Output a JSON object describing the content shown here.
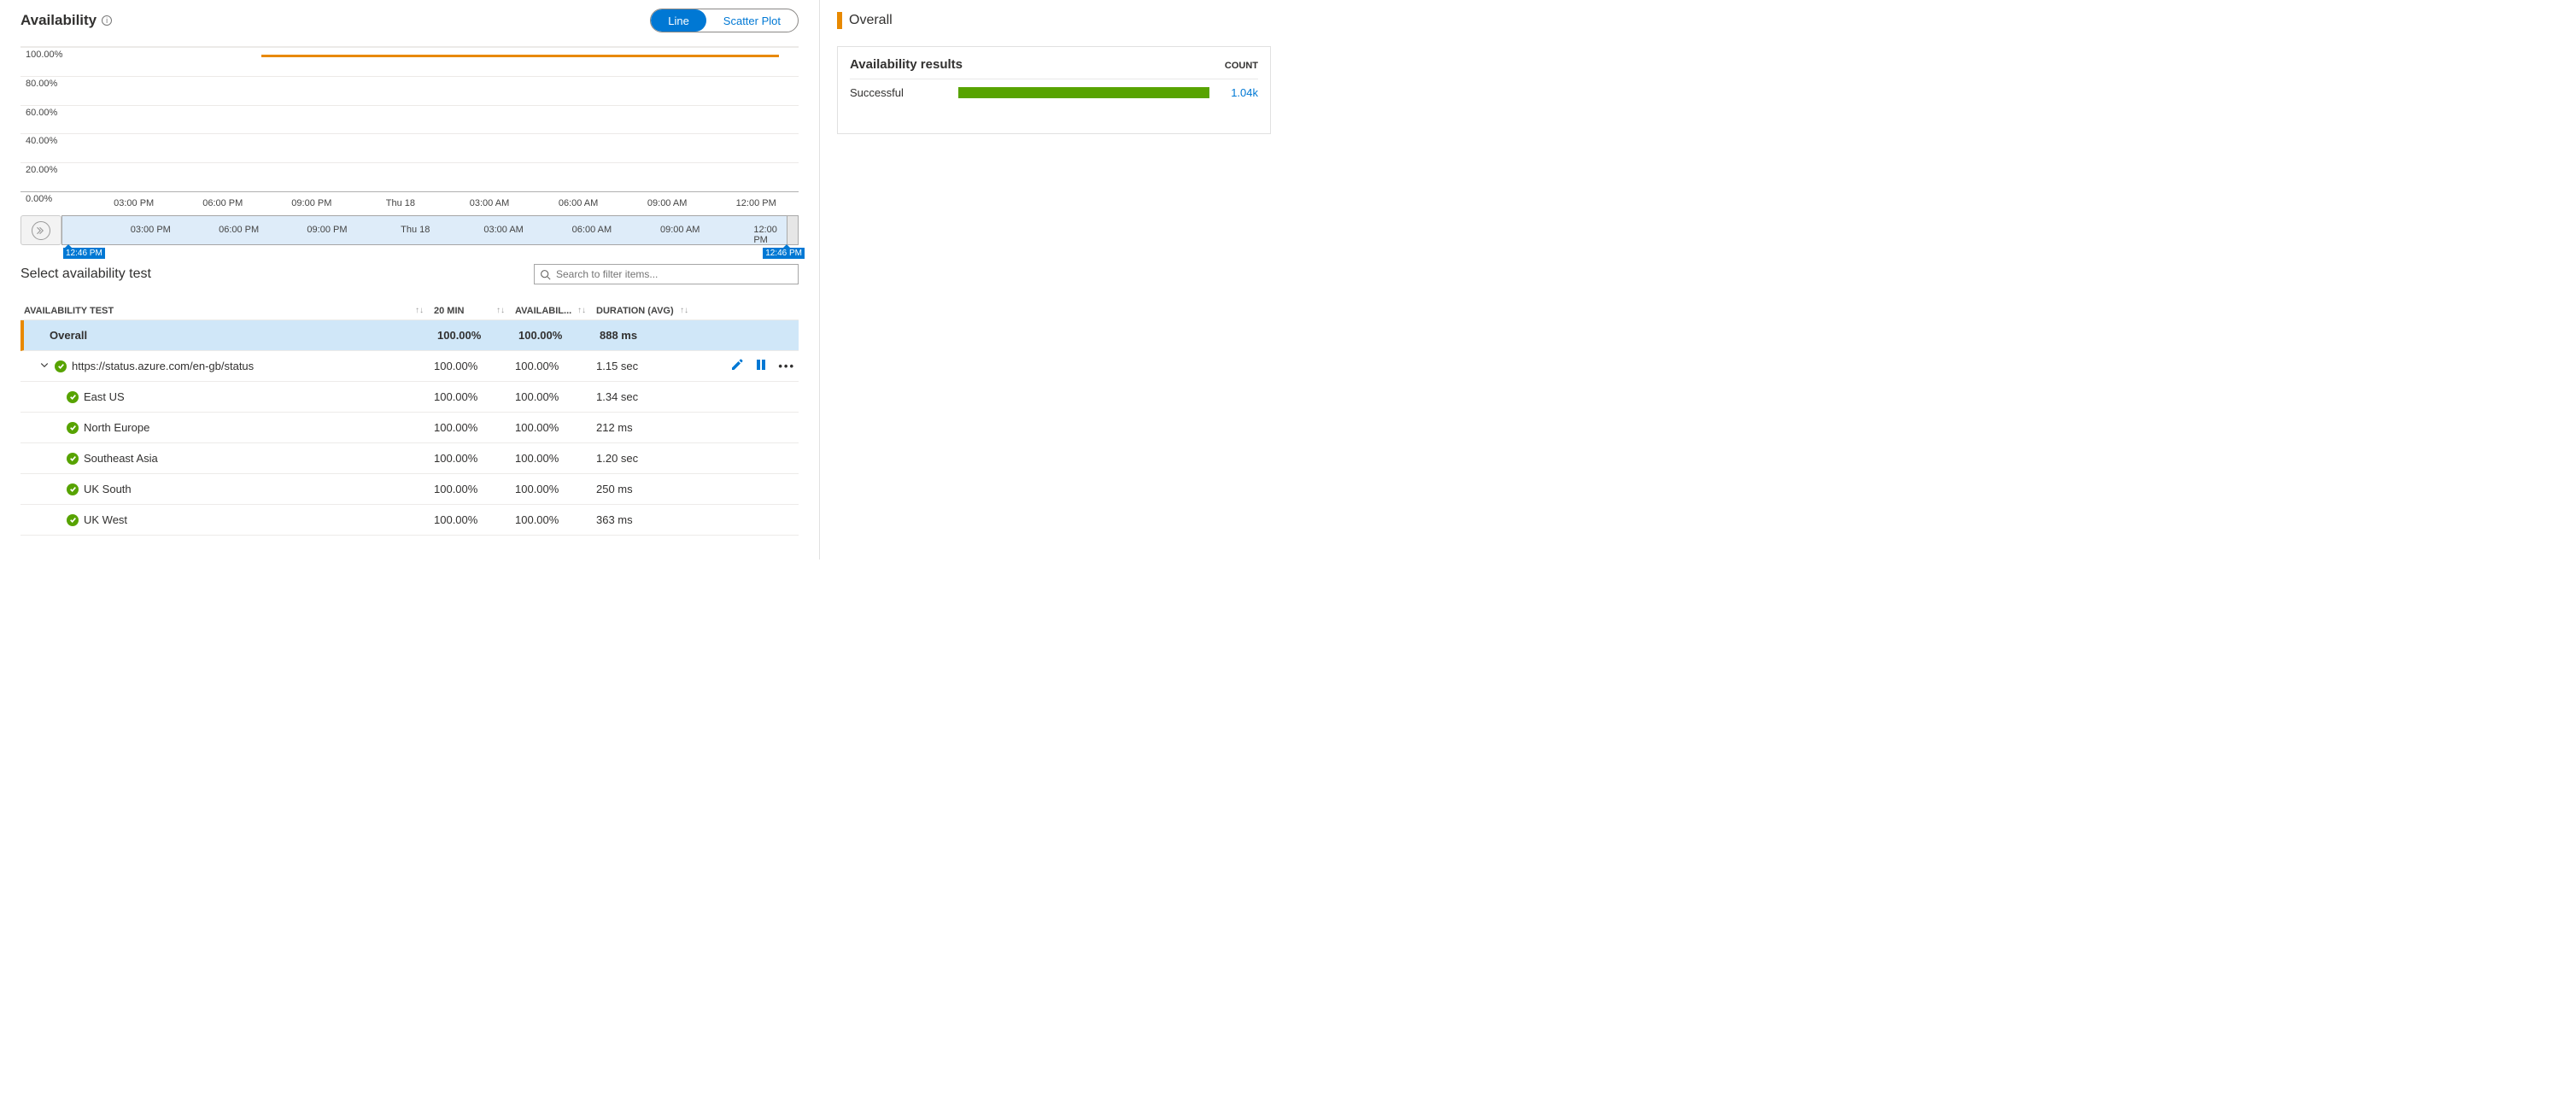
{
  "title": "Availability",
  "chart_toggle": {
    "line": "Line",
    "scatter": "Scatter Plot"
  },
  "chart_data": {
    "type": "line",
    "title": "Availability",
    "ylabel": "",
    "ylim": [
      0,
      100
    ],
    "y_ticks": [
      "100.00%",
      "80.00%",
      "60.00%",
      "40.00%",
      "20.00%",
      "0.00%"
    ],
    "x_ticks": [
      "03:00 PM",
      "06:00 PM",
      "09:00 PM",
      "Thu 18",
      "03:00 AM",
      "06:00 AM",
      "09:00 AM",
      "12:00 PM"
    ],
    "series": [
      {
        "name": "Overall",
        "value_pct": 100,
        "span_start_frac": 0.31,
        "span_end_frac": 0.975
      }
    ]
  },
  "timeline": {
    "x_ticks": [
      "03:00 PM",
      "06:00 PM",
      "09:00 PM",
      "Thu 18",
      "03:00 AM",
      "06:00 AM",
      "09:00 AM",
      "12:00 PM"
    ],
    "start_label": "12:46 PM",
    "end_label": "12:46 PM"
  },
  "sub_title": "Select availability test",
  "search": {
    "placeholder": "Search to filter items..."
  },
  "columns": {
    "name": "Availability Test",
    "twenty_min": "20 min",
    "availability": "Availabil...",
    "duration": "Duration (avg)"
  },
  "overall_row": {
    "name": "Overall",
    "twenty_min": "100.00%",
    "availability": "100.00%",
    "duration": "888 ms"
  },
  "tests": [
    {
      "name": "https://status.azure.com/en-gb/status",
      "twenty_min": "100.00%",
      "availability": "100.00%",
      "duration": "1.15 sec",
      "expandable": true,
      "actions": true,
      "children": [
        {
          "name": "East US",
          "twenty_min": "100.00%",
          "availability": "100.00%",
          "duration": "1.34 sec"
        },
        {
          "name": "North Europe",
          "twenty_min": "100.00%",
          "availability": "100.00%",
          "duration": "212 ms"
        },
        {
          "name": "Southeast Asia",
          "twenty_min": "100.00%",
          "availability": "100.00%",
          "duration": "1.20 sec"
        },
        {
          "name": "UK South",
          "twenty_min": "100.00%",
          "availability": "100.00%",
          "duration": "250 ms"
        },
        {
          "name": "UK West",
          "twenty_min": "100.00%",
          "availability": "100.00%",
          "duration": "363 ms"
        }
      ]
    }
  ],
  "side": {
    "title": "Overall",
    "card_title": "Availability results",
    "count_label": "COUNT",
    "rows": [
      {
        "name": "Successful",
        "count": "1.04k",
        "bar_frac": 1.0
      }
    ]
  }
}
